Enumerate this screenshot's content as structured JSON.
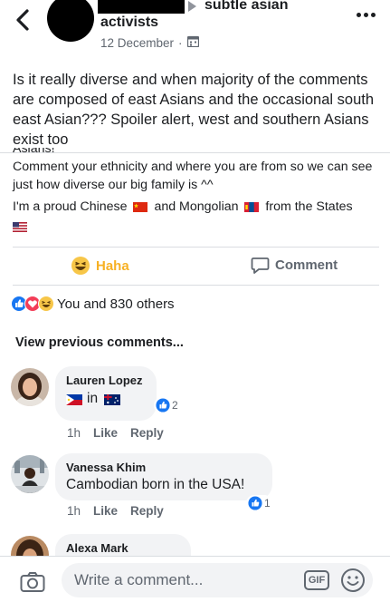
{
  "post": {
    "group_name": "subtle asian",
    "author": "activists",
    "date": "12 December",
    "text": "Is it really diverse and when majority of the comments are composed of east Asians and the occasional south east Asian??? Spoiler alert, west and southern Asians exist too"
  },
  "shared": {
    "clipped_line": "Asians!",
    "line1": "Comment your ethnicity and where you are from so we can see just how diverse our big family is ^^",
    "line2_a": "I'm a proud Chinese",
    "line2_b": "and Mongolian",
    "line2_c": "from the States"
  },
  "actions": {
    "haha_label": "Haha",
    "comment_label": "Comment"
  },
  "reactions": {
    "summary": "You and 830 others"
  },
  "view_previous": "View previous comments...",
  "comments": [
    {
      "name": "Lauren Lopez",
      "text_in": "in",
      "time": "1h",
      "like": "Like",
      "reply": "Reply",
      "reaction_count": "2"
    },
    {
      "name": "Vanessa Khim",
      "text": "Cambodian born in the USA!",
      "time": "1h",
      "like": "Like",
      "reply": "Reply",
      "reaction_count": "1"
    },
    {
      "name": "Alexa Mark"
    }
  ],
  "composer": {
    "placeholder": "Write a comment...",
    "gif_label": "GIF"
  },
  "colors": {
    "haha_accent": "#f7b125",
    "like_blue": "#1877f2",
    "love_red": "#f33e58",
    "text_muted": "#606770",
    "bubble_bg": "#f2f3f5"
  },
  "icons": [
    "back-arrow-icon",
    "more-options-icon",
    "calendar-icon",
    "haha-icon",
    "comment-icon",
    "like-reaction-icon",
    "love-reaction-icon",
    "camera-icon",
    "gif-icon",
    "emoji-icon"
  ]
}
